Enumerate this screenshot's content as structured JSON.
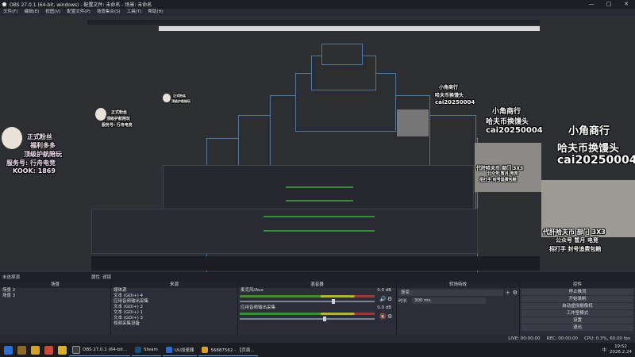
{
  "window": {
    "title": "OBS 27.0.1 (64-bit, windows) - 配置文件: 未命名 - 场景: 未命名",
    "minimize": "—",
    "maximize": "□",
    "close": "✕"
  },
  "menu": [
    "文件(F)",
    "编辑(E)",
    "视图(V)",
    "配置文件(P)",
    "场景集合(S)",
    "工具(T)",
    "帮助(H)"
  ],
  "overlay": {
    "line1": "小角商行",
    "line2": "哈夫币换馒头",
    "line3": "cai20250004",
    "left_badge": [
      "正式粉丝",
      "福利多多",
      "顶级护航陪玩",
      "服务号: 行舟电竞",
      "KOOK: 1869"
    ],
    "webcam_caption1": "代肝哈夫币 部门 3X3",
    "webcam_caption2": "公众号 暂月 电竞",
    "webcam_caption3": "招打手 封号追费包赔"
  },
  "scene_strip": {
    "label": "未选择源",
    "properties": "属性",
    "filters": "滤镜"
  },
  "scenes": {
    "title": "场景",
    "items": [
      "场景 2",
      "场景 3"
    ]
  },
  "sources": {
    "title": "来源",
    "items": [
      "媒体源",
      "文本 (GDI+) 4",
      "应用音频输出采集",
      "文本 (GDI+) 2",
      "文本 (GDI+) 1",
      "文本 (GDI+) 3",
      "视频采集设备"
    ]
  },
  "mixer": {
    "title": "混音器",
    "channels": [
      {
        "name": "麦克风/Aux",
        "db": "0.0 dB",
        "level": 0.68
      },
      {
        "name": "应用音频输出采集",
        "db": "0.0 dB",
        "level": 0.62
      }
    ]
  },
  "transitions": {
    "title": "转场特效",
    "type": "渐变",
    "duration_label": "时长",
    "duration": "300 ms"
  },
  "controls": {
    "title": "控件",
    "buttons": [
      "停止推流",
      "开始录制",
      "启动虚拟摄像机",
      "工作室模式",
      "设置",
      "退出"
    ]
  },
  "status": {
    "live": "LIVE: 00:00:00",
    "rec": "REC: 00:00:00",
    "cpu": "CPU: 0.3%, 60.00 fps"
  },
  "taskbar": {
    "apps": [
      {
        "label": "OBS 27.0.1 (64-bit...",
        "color": "#3b3b3b"
      },
      {
        "label": "Steam",
        "color": "#1b4d7a"
      },
      {
        "label": "UU加速器",
        "color": "#2d6cd0"
      },
      {
        "label": "56887562 - 【页面...",
        "color": "#d8a02a"
      }
    ],
    "tray_text": "中",
    "time": "19:52",
    "date": "2026.2.24"
  },
  "colors": {
    "accent": "#3a5f8c",
    "meter_green": "#3e8a3e",
    "meter_yellow": "#b4b43a",
    "meter_red": "#9a3b3b"
  }
}
